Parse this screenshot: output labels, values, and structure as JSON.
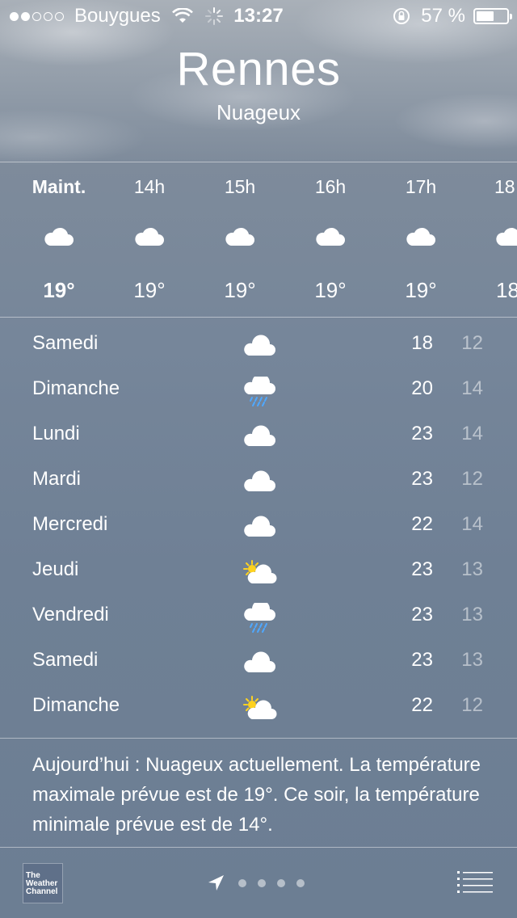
{
  "status_bar": {
    "signal_dots_filled": 2,
    "signal_dots_total": 5,
    "carrier": "Bouygues",
    "time": "13:27",
    "battery_percent": "57 %",
    "battery_level": 0.57
  },
  "header": {
    "city": "Rennes",
    "condition": "Nuageux"
  },
  "hourly": [
    {
      "label": "Maint.",
      "icon": "cloud-icon",
      "temp": "19°"
    },
    {
      "label": "14h",
      "icon": "cloud-icon",
      "temp": "19°"
    },
    {
      "label": "15h",
      "icon": "cloud-icon",
      "temp": "19°"
    },
    {
      "label": "16h",
      "icon": "cloud-icon",
      "temp": "19°"
    },
    {
      "label": "17h",
      "icon": "cloud-icon",
      "temp": "19°"
    },
    {
      "label": "18",
      "icon": "cloud-icon",
      "temp": "18"
    }
  ],
  "daily": [
    {
      "day": "Samedi",
      "icon": "cloud-icon",
      "high": "18",
      "low": "12"
    },
    {
      "day": "Dimanche",
      "icon": "rain-cloud-icon",
      "high": "20",
      "low": "14"
    },
    {
      "day": "Lundi",
      "icon": "cloud-icon",
      "high": "23",
      "low": "14"
    },
    {
      "day": "Mardi",
      "icon": "cloud-icon",
      "high": "23",
      "low": "12"
    },
    {
      "day": "Mercredi",
      "icon": "cloud-icon",
      "high": "22",
      "low": "14"
    },
    {
      "day": "Jeudi",
      "icon": "partly-sunny-icon",
      "high": "23",
      "low": "13"
    },
    {
      "day": "Vendredi",
      "icon": "rain-cloud-icon",
      "high": "23",
      "low": "13"
    },
    {
      "day": "Samedi",
      "icon": "cloud-icon",
      "high": "23",
      "low": "13"
    },
    {
      "day": "Dimanche",
      "icon": "partly-sunny-icon",
      "high": "22",
      "low": "12"
    }
  ],
  "summary": "Aujourd’hui : Nuageux actuellement. La température maximale prévue est de 19°. Ce soir, la température minimale prévue est de 14°.",
  "bottom_bar": {
    "logo_text": [
      "The",
      "Weather",
      "Channel"
    ],
    "page_count": 4,
    "icons": [
      "location-arrow-icon",
      "list-icon"
    ]
  }
}
